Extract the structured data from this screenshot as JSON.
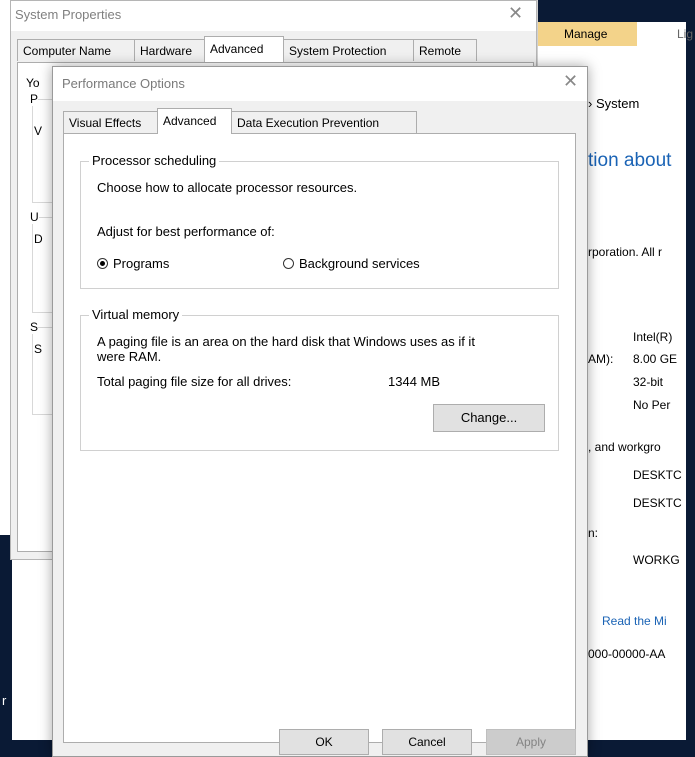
{
  "background": {
    "left_fragments": [
      "r"
    ],
    "system_window": {
      "ribbon_tabs": [
        "Manage",
        "Lig"
      ],
      "breadcrumb": "› System",
      "heading": "tion about",
      "copyright": "rporation. All r",
      "specs": [
        {
          "label": "",
          "value": "Intel(R)"
        },
        {
          "label": "AM):",
          "value": "8.00 GE"
        },
        {
          "label": "",
          "value": "32-bit"
        },
        {
          "label": "",
          "value": "No Per"
        }
      ],
      "workgroup_heading": ", and workgro",
      "computer_values": [
        "DESKTC",
        "DESKTC"
      ],
      "domain_label": "n:",
      "workgroup_value": "WORKG",
      "read_link": "Read the Mi",
      "product_id": "000-00000-AA"
    }
  },
  "system_properties": {
    "title": "System Properties",
    "tabs": [
      "Computer Name",
      "Hardware",
      "Advanced",
      "System Protection",
      "Remote"
    ],
    "active_tab": "Advanced",
    "fragments": [
      "Yo",
      "P",
      "V",
      "U",
      "D",
      "S",
      "S"
    ]
  },
  "performance_options": {
    "title": "Performance Options",
    "tabs": [
      "Visual Effects",
      "Advanced",
      "Data Execution Prevention"
    ],
    "active_tab": "Advanced",
    "processor_scheduling": {
      "legend": "Processor scheduling",
      "description": "Choose how to allocate processor resources.",
      "adjust_label": "Adjust for best performance of:",
      "options": [
        {
          "label": "Programs",
          "checked": true
        },
        {
          "label": "Background services",
          "checked": false
        }
      ]
    },
    "virtual_memory": {
      "legend": "Virtual memory",
      "description_line1": "A paging file is an area on the hard disk that Windows uses as if it",
      "description_line2": "were RAM.",
      "total_label": "Total paging file size for all drives:",
      "total_value": "1344 MB",
      "change_button": "Change..."
    },
    "buttons": {
      "ok": "OK",
      "cancel": "Cancel",
      "apply": "Apply"
    }
  }
}
